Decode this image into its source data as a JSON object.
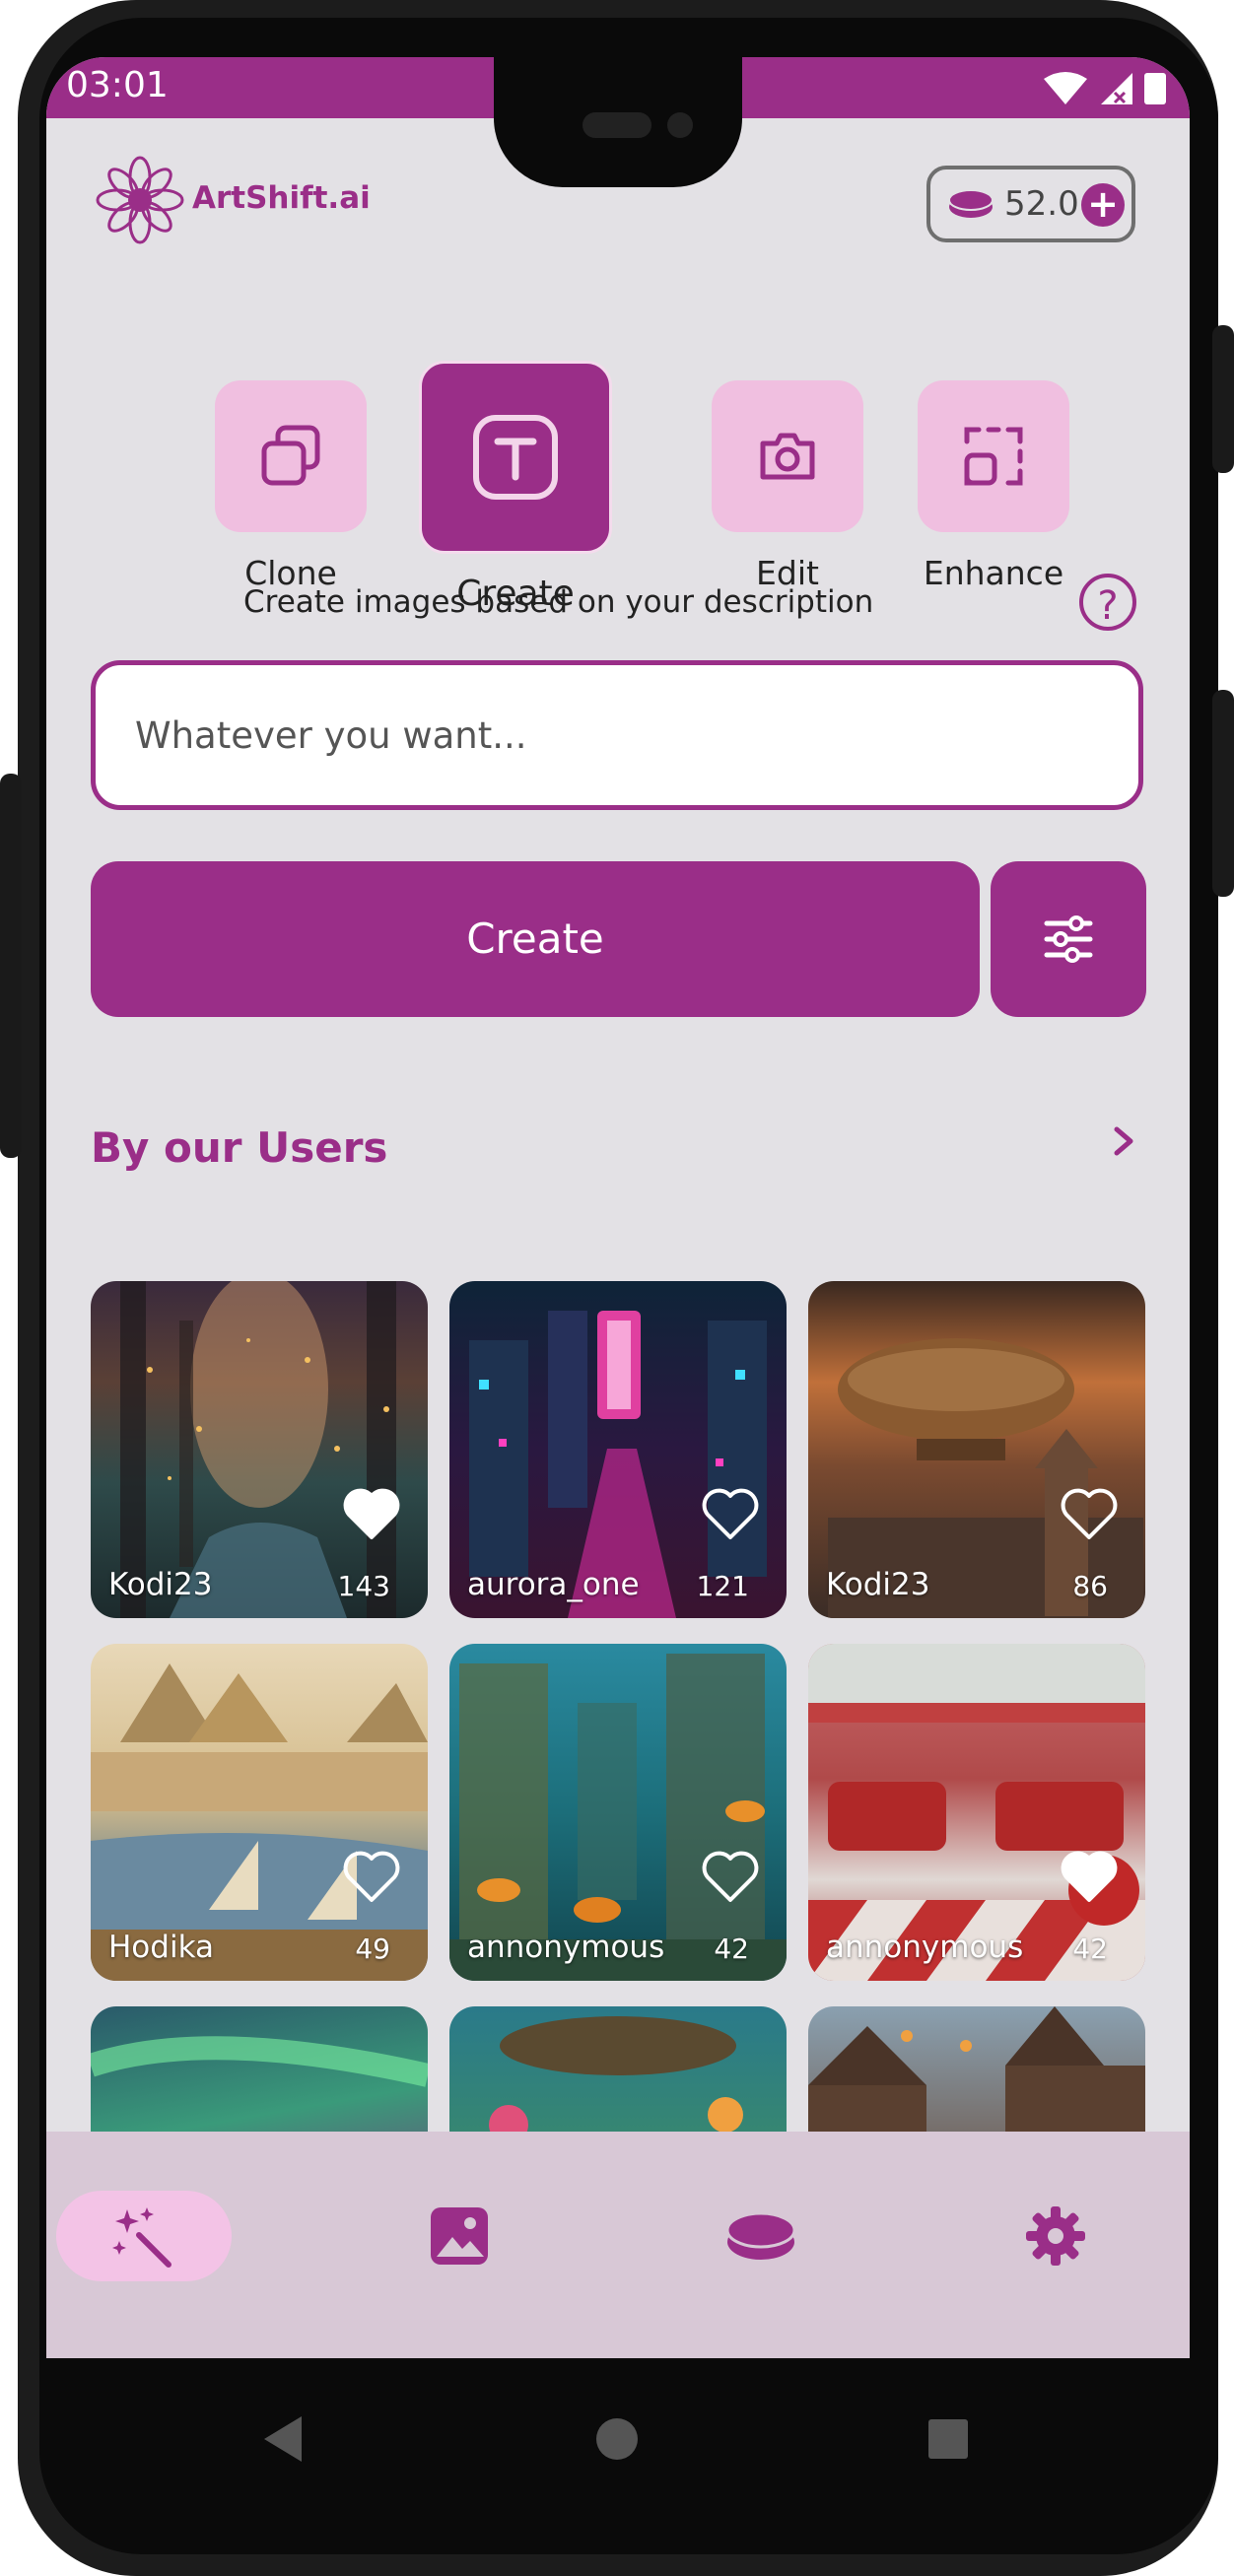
{
  "status": {
    "time": "03:01"
  },
  "header": {
    "logo_text": "ArtShift.ai",
    "credits": "52.0"
  },
  "modes": [
    {
      "label": "Clone",
      "icon": "copy-icon",
      "active": false
    },
    {
      "label": "Create",
      "icon": "text-icon",
      "active": true
    },
    {
      "label": "Edit",
      "icon": "camera-icon",
      "active": false
    },
    {
      "label": "Enhance",
      "icon": "crop-icon",
      "active": false
    }
  ],
  "description": "Create images based on your description",
  "prompt": {
    "placeholder": "Whatever you want..."
  },
  "create_button": "Create",
  "gallery": {
    "title": "By our Users",
    "cards": [
      {
        "user": "Kodi23",
        "likes": "143",
        "liked": true
      },
      {
        "user": "aurora_one",
        "likes": "121",
        "liked": false
      },
      {
        "user": "Kodi23",
        "likes": "86",
        "liked": false
      },
      {
        "user": "Hodika",
        "likes": "49",
        "liked": false
      },
      {
        "user": "annonymous",
        "likes": "42",
        "liked": false
      },
      {
        "user": "annonymous",
        "likes": "42",
        "liked": true
      },
      {
        "user": "",
        "likes": "",
        "liked": false
      },
      {
        "user": "",
        "likes": "",
        "liked": false
      },
      {
        "user": "",
        "likes": "",
        "liked": false
      }
    ]
  },
  "bottom_nav": [
    {
      "icon": "magic-wand-icon",
      "active": true
    },
    {
      "icon": "gallery-icon",
      "active": false
    },
    {
      "icon": "coins-icon",
      "active": false
    },
    {
      "icon": "gear-icon",
      "active": false
    }
  ],
  "colors": {
    "accent": "#9a2e88",
    "tile": "#f0bfe0",
    "background": "#e3e1e5"
  }
}
